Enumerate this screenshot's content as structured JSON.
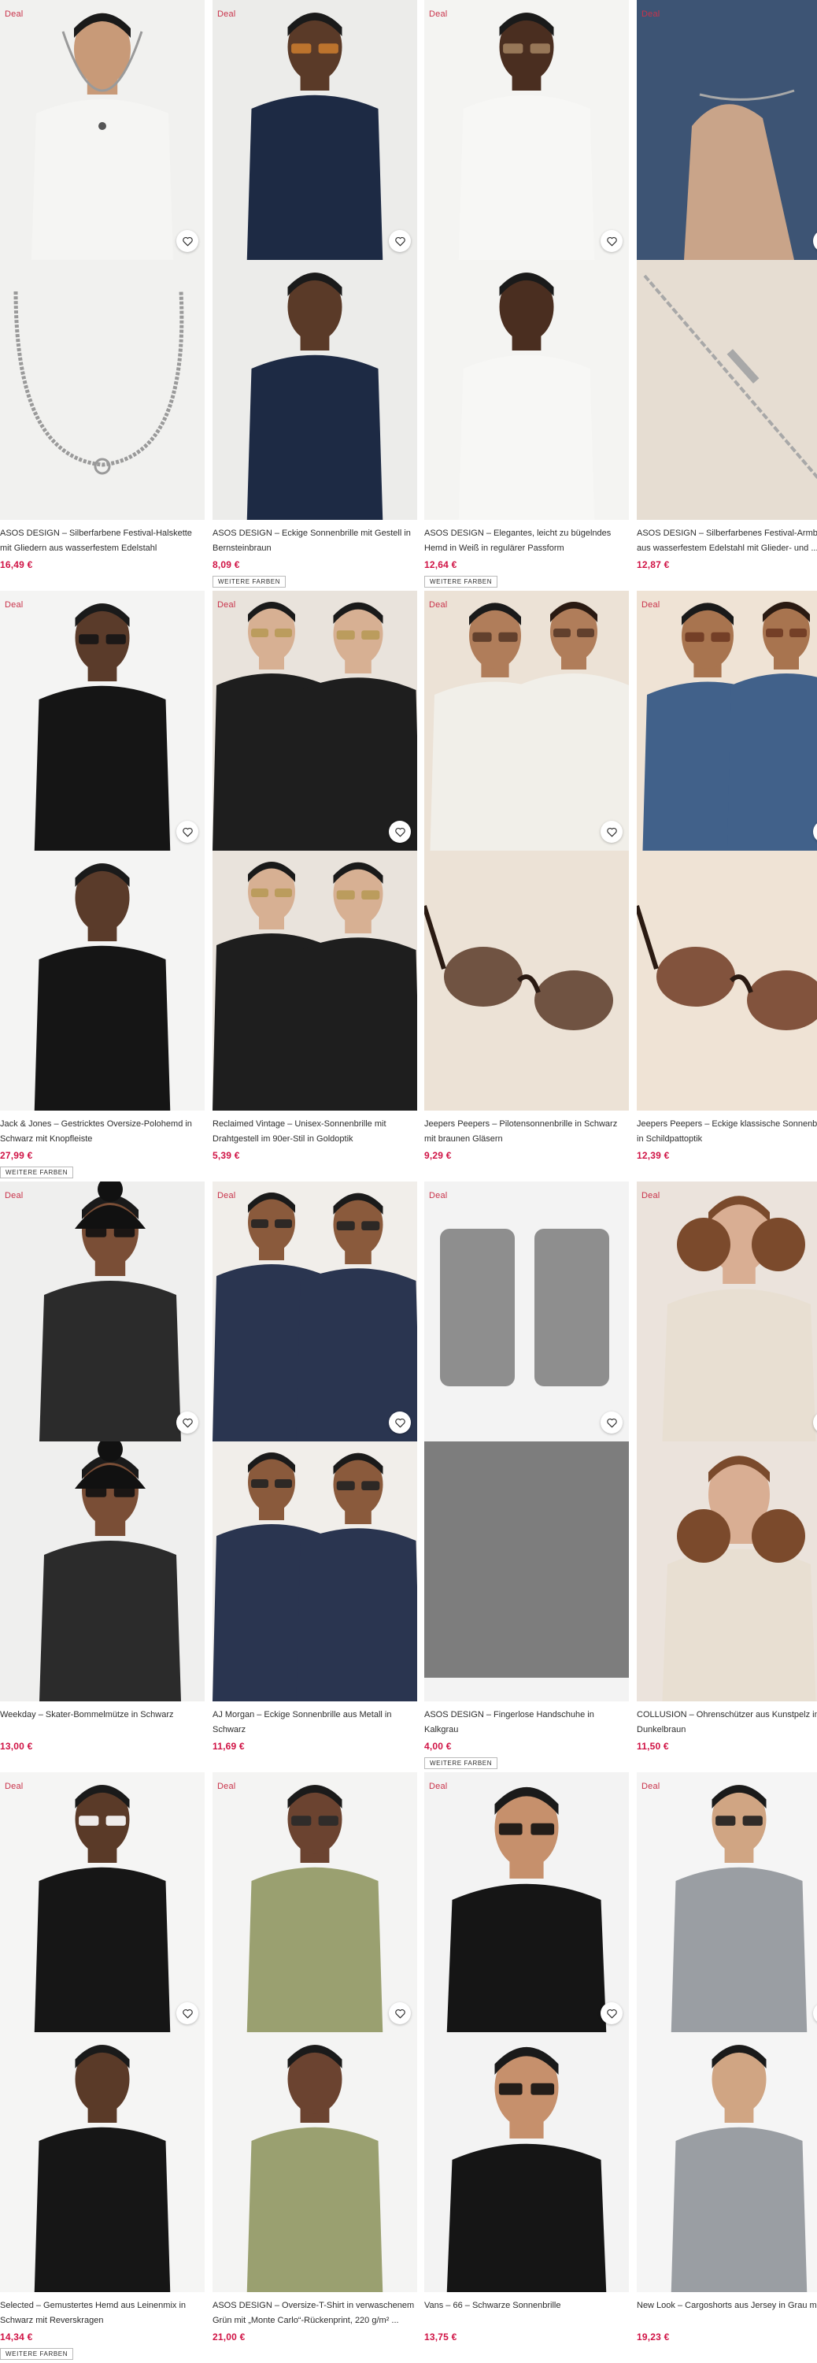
{
  "products": [
    {
      "badge": "Deal",
      "title": "ASOS DESIGN – Silberfarbene Festival-Halskette mit Gliedern aus wasserfestem Edelstahl",
      "price": "16,49 €",
      "more": "",
      "scene": "necklace",
      "bg": "#f1f1ef",
      "skin": "#c89a78",
      "shirt": "#f5f5f3",
      "pants": "#f5f5f3",
      "acc": "#9a9a9a"
    },
    {
      "badge": "Deal",
      "title": "ASOS DESIGN – Eckige Sonnenbrille mit Gestell in Bernsteinbraun",
      "price": "8,09 €",
      "more": "WEITERE FARBEN",
      "scene": "person",
      "bg": "#ececea",
      "skin": "#5a3a28",
      "shirt": "#1d2a44",
      "pants": "#f4f4f2",
      "acc": "#c67a2e"
    },
    {
      "badge": "Deal",
      "title": "ASOS DESIGN – Elegantes, leicht zu bügelndes Hemd in Weiß in regulärer Passform",
      "price": "12,64 €",
      "more": "WEITERE FARBEN",
      "scene": "person",
      "bg": "#f4f4f2",
      "skin": "#4a2e20",
      "shirt": "#f7f7f5",
      "pants": "#222222",
      "acc": "#a07f5e"
    },
    {
      "badge": "Deal",
      "title": "ASOS DESIGN – Silberfarbenes Festival-Armband aus wasserfestem Edelstahl mit Glieder- und ...",
      "price": "12,87 €",
      "more": "",
      "scene": "bracelet",
      "bg": "#e6ddd2",
      "skin": "#c9a489",
      "shirt": "#3d5474",
      "pants": "#3d5474",
      "acc": "#a8a8a8"
    },
    {
      "badge": "Deal",
      "title": "Jack & Jones – Gestricktes Oversize-Polohemd in Schwarz mit Knopfleiste",
      "price": "27,99 €",
      "more": "WEITERE FARBEN",
      "scene": "person",
      "bg": "#f4f4f3",
      "skin": "#5a3b2a",
      "shirt": "#151515",
      "pants": "#f2f2f2",
      "acc": "#151515"
    },
    {
      "badge": "Deal",
      "title": "Reclaimed Vintage – Unisex-Sonnenbrille mit Drahtgestell im 90er-Stil in Goldoptik",
      "price": "5,39 €",
      "more": "",
      "scene": "couple",
      "bg": "#e9e3dc",
      "skin": "#d7b093",
      "shirt": "#1e1e1e",
      "pants": "#2a2a2a",
      "acc": "#b89a58"
    },
    {
      "badge": "Deal",
      "title": "Jeepers Peepers – Pilotensonnenbrille in Schwarz mit braunen Gläsern",
      "price": "9,29 €",
      "more": "",
      "scene": "sunglasses",
      "bg": "#ece2d6",
      "skin": "#b07d5a",
      "shirt": "#f1efe9",
      "pants": "#3a3a3a",
      "acc": "#5a3a28"
    },
    {
      "badge": "Deal",
      "title": "Jeepers Peepers – Eckige klassische Sonnenbrille in Schildpattoptik",
      "price": "12,39 €",
      "more": "",
      "scene": "sunglasses",
      "bg": "#efe3d5",
      "skin": "#a8744f",
      "shirt": "#41618a",
      "pants": "#41618a",
      "acc": "#6e3a22"
    },
    {
      "badge": "Deal",
      "title": "Weekday – Skater-Bommelmütze in Schwarz",
      "price": "13,00 €",
      "more": "",
      "scene": "beanie",
      "bg": "#efefee",
      "skin": "#7a4e36",
      "shirt": "#2b2b2b",
      "pants": "#2b2b2b",
      "acc": "#111111"
    },
    {
      "badge": "Deal",
      "title": "AJ Morgan – Eckige Sonnenbrille aus Metall in Schwarz",
      "price": "11,69 €",
      "more": "",
      "scene": "couple",
      "bg": "#f1eeea",
      "skin": "#8a5a3c",
      "shirt": "#2a3550",
      "pants": "#7b1f27",
      "acc": "#222222"
    },
    {
      "badge": "Deal",
      "title": "ASOS DESIGN – Fingerlose Handschuhe in Kalkgrau",
      "price": "4,00 €",
      "more": "WEITERE FARBEN",
      "scene": "gloves",
      "bg": "#f3f3f3",
      "skin": "#888888",
      "shirt": "#7a7a7a",
      "pants": "#7a7a7a",
      "acc": "#4a4a4a"
    },
    {
      "badge": "Deal",
      "title": "COLLUSION – Ohrenschützer aus Kunstpelz in Dunkelbraun",
      "price": "11,50 €",
      "more": "",
      "scene": "earmuffs",
      "bg": "#ebe3dc",
      "skin": "#d9ae93",
      "shirt": "#e8dfd2",
      "pants": "#e8dfd2",
      "acc": "#7b4a2c"
    },
    {
      "badge": "Deal",
      "title": "Selected – Gemustertes Hemd aus Leinenmix in Schwarz mit Reverskragen",
      "price": "14,34 €",
      "more": "WEITERE FARBEN",
      "scene": "person",
      "bg": "#f5f5f4",
      "skin": "#5a3a28",
      "shirt": "#161616",
      "pants": "#f2f2f2",
      "acc": "#ffffff"
    },
    {
      "badge": "Deal",
      "title": "ASOS DESIGN – Oversize-T-Shirt in verwaschenem Grün mit „Monte Carlo“-Rückenprint, 220 g/m² ...",
      "price": "21,00 €",
      "more": "",
      "scene": "person",
      "bg": "#f4f4f3",
      "skin": "#6b4330",
      "shirt": "#9aa070",
      "pants": "#1e1e1e",
      "acc": "#2a2a2a"
    },
    {
      "badge": "Deal",
      "title": "Vans – 66 – Schwarze Sonnenbrille",
      "price": "13,75 €",
      "more": "",
      "scene": "portrait",
      "bg": "#f3f3f3",
      "skin": "#c6906c",
      "shirt": "#151515",
      "pants": "#151515",
      "acc": "#111111"
    },
    {
      "badge": "Deal",
      "title": "New Look – Cargoshorts aus Jersey in Grau meliert",
      "price": "19,23 €",
      "more": "",
      "scene": "person",
      "bg": "#f5f5f5",
      "skin": "#d0a583",
      "shirt": "#9a9ea3",
      "pants": "#9a9ea3",
      "acc": "#1e1e1e"
    }
  ],
  "labels": {
    "save_icon": "heart-icon"
  }
}
